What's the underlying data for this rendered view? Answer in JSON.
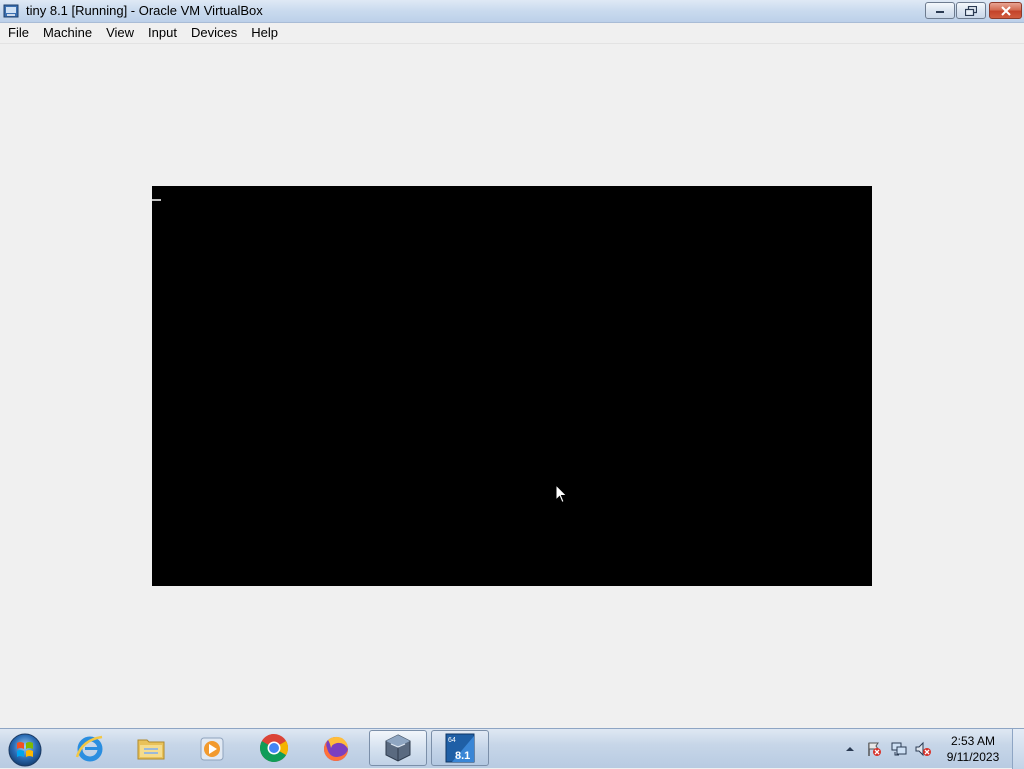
{
  "window": {
    "title": "tiny 8.1 [Running] - Oracle VM VirtualBox"
  },
  "menu": {
    "items": [
      {
        "label": "File"
      },
      {
        "label": "Machine"
      },
      {
        "label": "View"
      },
      {
        "label": "Input"
      },
      {
        "label": "Devices"
      },
      {
        "label": "Help"
      }
    ]
  },
  "titlebar_buttons": {
    "minimize": "minimize-icon",
    "maximize": "restore-icon",
    "close": "close-icon"
  },
  "vm": {
    "state": "Running",
    "screen_color": "#000000"
  },
  "taskbar": {
    "pinned": [
      {
        "name": "internet-explorer-icon"
      },
      {
        "name": "file-explorer-icon"
      },
      {
        "name": "media-player-icon"
      },
      {
        "name": "chrome-icon"
      },
      {
        "name": "firefox-icon"
      },
      {
        "name": "virtualbox-icon"
      },
      {
        "name": "tiny-8-1-vm-icon",
        "badge": "8.1",
        "badge_top": "64"
      }
    ],
    "clock": {
      "time": "2:53 AM",
      "date": "9/11/2023"
    }
  },
  "colors": {
    "accent": "#c4432a",
    "titlebar": "#c9daee",
    "taskbar": "#c7d6e8"
  }
}
